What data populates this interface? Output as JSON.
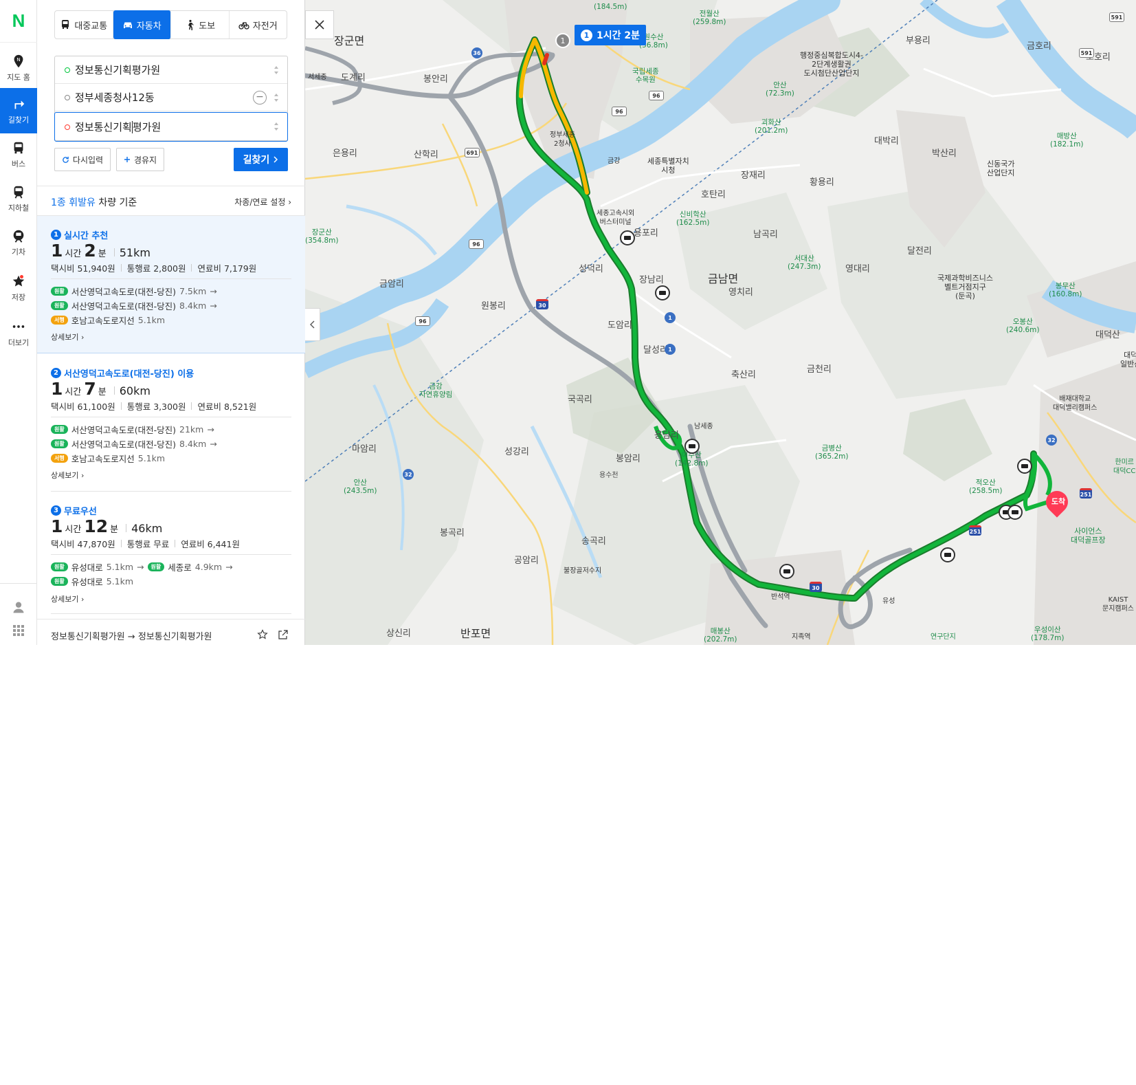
{
  "rail": {
    "logo": "N",
    "items": [
      {
        "label": "지도 홈",
        "icon": "map-pin-icon"
      },
      {
        "label": "길찾기",
        "icon": "directions-icon"
      },
      {
        "label": "버스",
        "icon": "bus-icon"
      },
      {
        "label": "지하철",
        "icon": "subway-icon"
      },
      {
        "label": "기차",
        "icon": "train-icon"
      },
      {
        "label": "저장",
        "icon": "star-icon"
      },
      {
        "label": "더보기",
        "icon": "more-icon"
      }
    ]
  },
  "modes": [
    {
      "label": "대중교통",
      "icon": "bus-icon"
    },
    {
      "label": "자동차",
      "icon": "car-icon",
      "active": true
    },
    {
      "label": "도보",
      "icon": "walk-icon"
    },
    {
      "label": "자전거",
      "icon": "bicycle-icon"
    }
  ],
  "inputs": {
    "origin": "정보통신기획평가원",
    "waypoint": "정부세종청사12동",
    "destination_before_caret": "정보통신기획",
    "destination_after_caret": "평가원"
  },
  "actions": {
    "reset": "다시입력",
    "waypoint": "경유지",
    "search": "길찾기"
  },
  "vehicle": {
    "prefix": "1종 휘발유",
    "suffix": "차량 기준",
    "settings": "차종/연료 설정"
  },
  "routes": [
    {
      "num": "1",
      "title": "실시간 추천",
      "hours": "1",
      "hours_unit": "시간",
      "minutes": "2",
      "minutes_unit": "분",
      "distance": "51km",
      "taxi": "택시비 51,940원",
      "toll": "통행료 2,800원",
      "fuel": "연료비 7,179원",
      "segments": [
        {
          "badge": "원활",
          "road": "서산영덕고속도로(대전-당진)",
          "km": "7.5km"
        },
        {
          "badge": "원활",
          "road": "서산영덕고속도로(대전-당진)",
          "km": "8.4km"
        },
        {
          "badge": "서행",
          "road": "호남고속도로지선",
          "km": "5.1km"
        }
      ],
      "detail": "상세보기"
    },
    {
      "num": "2",
      "title": "서산영덕고속도로(대전-당진) 이용",
      "hours": "1",
      "hours_unit": "시간",
      "minutes": "7",
      "minutes_unit": "분",
      "distance": "60km",
      "taxi": "택시비 61,100원",
      "toll": "통행료 3,300원",
      "fuel": "연료비 8,521원",
      "segments": [
        {
          "badge": "원활",
          "road": "서산영덕고속도로(대전-당진)",
          "km": "21km"
        },
        {
          "badge": "원활",
          "road": "서산영덕고속도로(대전-당진)",
          "km": "8.4km"
        },
        {
          "badge": "서행",
          "road": "호남고속도로지선",
          "km": "5.1km"
        }
      ],
      "detail": "상세보기"
    },
    {
      "num": "3",
      "title": "무료우선",
      "hours": "1",
      "hours_unit": "시간",
      "minutes": "12",
      "minutes_unit": "분",
      "distance": "46km",
      "taxi": "택시비 47,870원",
      "toll": "통행료 무료",
      "fuel": "연료비 6,441원",
      "segments": [
        {
          "badge": "원활",
          "road": "유성대로",
          "km": "5.1km",
          "badge2": "원활",
          "road2": "세종로",
          "km2": "4.9km"
        },
        {
          "badge": "원활",
          "road": "유성대로",
          "km": "5.1km"
        }
      ],
      "detail": "상세보기"
    }
  ],
  "footer": {
    "from": "정보통신기획평가원",
    "arrow": "→",
    "to": "정보통신기획평가원"
  },
  "map": {
    "bubble_num": "1",
    "bubble_text": "1시간 2분",
    "start_num": "1",
    "arrive": "도착",
    "places": [
      "장군면",
      "금남면",
      "반포면",
      "도계리",
      "봉안리",
      "은용리",
      "산학리",
      "부용리",
      "금호리",
      "노호리",
      "대박리",
      "박산리",
      "장재리",
      "황용리",
      "호탄리",
      "남곡리",
      "달전리",
      "영대리",
      "영치리",
      "금암리",
      "원봉리",
      "성덕리",
      "도암리",
      "축산리",
      "금천리",
      "국곡리",
      "마암리",
      "성강리",
      "봉암리",
      "용담리",
      "송곡리",
      "봉곡리",
      "공암리",
      "상신리",
      "용포리",
      "대덕산",
      "장남리",
      "달성리",
      "용수천"
    ],
    "pois": [
      {
        "name": "전월산",
        "elev": "(259.8m)"
      },
      {
        "name": "국립세종",
        "elev": "수목원"
      },
      {
        "name": "안산",
        "elev": "(72.3m)"
      },
      {
        "name": "괴화산",
        "elev": "(201.2m)"
      },
      {
        "name": "매방산",
        "elev": "(182.1m)"
      },
      {
        "name": "장군산",
        "elev": "(354.8m)"
      },
      {
        "name": "신비학산",
        "elev": "(162.5m)"
      },
      {
        "name": "서대산",
        "elev": "(247.3m)"
      },
      {
        "name": "봉무산",
        "elev": "(160.8m)"
      },
      {
        "name": "오봉산",
        "elev": "(240.6m)"
      },
      {
        "name": "금강",
        "elev": "자연휴양림"
      },
      {
        "name": "금병산",
        "elev": "(365.2m)"
      },
      {
        "name": "적오산",
        "elev": "(258.5m)"
      },
      {
        "name": "안산",
        "elev": "(243.5m)"
      },
      {
        "name": "여수산",
        "elev": "(142.8m)"
      },
      {
        "name": "매봉산",
        "elev": "(202.7m)"
      },
      {
        "name": "우성이산",
        "elev": "(178.7m)"
      },
      {
        "name": "(184.5m)",
        "elev": ""
      },
      {
        "name": "원수산",
        "elev": "(56.8m)"
      }
    ],
    "buildings": [
      "행정중심복합도시4-",
      "2단계생활권",
      "도시첨단산업단지",
      "세종특별자치",
      "시청",
      "신동국가",
      "산업단지",
      "국제과학비즈니스",
      "벨트거점지구",
      "(둔곡)",
      "배재대학교",
      "대덕밸리캠퍼스",
      "사이언스",
      "대덕골프장",
      "KAIST",
      "문지캠퍼스",
      "정부세종",
      "2청사",
      "세종고속시외",
      "버스터미널",
      "불장골저수지",
      "반석역",
      "지족역",
      "연구단지",
      "서세종",
      "금강",
      "남세종",
      "유성",
      "한미르",
      "대덕CC",
      "대덕",
      "일반산",
      "대덕산"
    ],
    "shields": [
      "591",
      "591",
      "36",
      "96",
      "96",
      "96",
      "691",
      "96",
      "30",
      "1",
      "1",
      "32",
      "30",
      "251",
      "251",
      "32"
    ],
    "colors": {
      "route_main": "#12b53b",
      "route_slow": "#f5b800",
      "route_alt": "#9ea4ab",
      "water": "#a9d4f2",
      "accent": "#0c6fe8"
    }
  }
}
